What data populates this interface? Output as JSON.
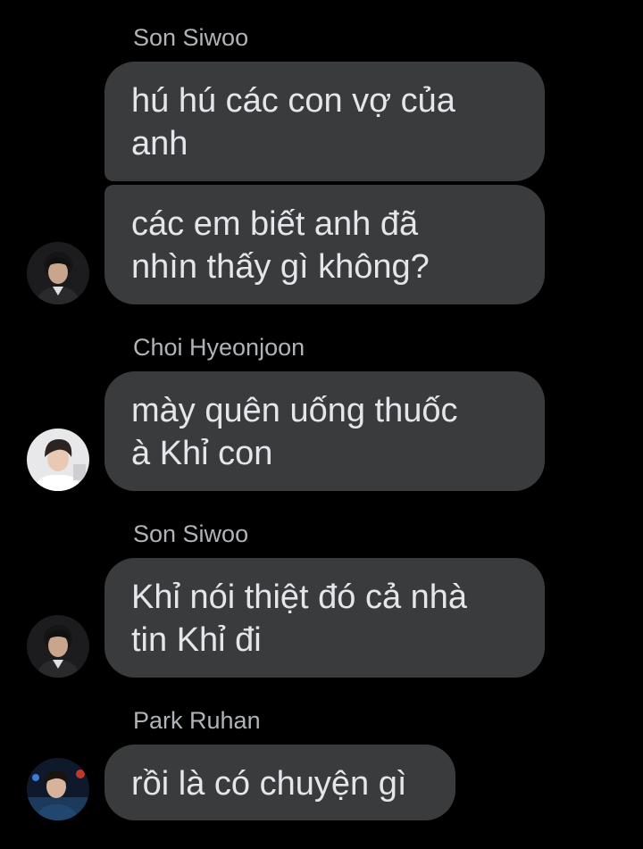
{
  "conversation": {
    "groups": [
      {
        "sender": "Son Siwoo",
        "messages": [
          "hú hú các con vợ của\nanh",
          "các em biết anh đã\nnhìn thấy gì không?"
        ],
        "avatar_icon": "user-avatar-son-siwoo"
      },
      {
        "sender": "Choi Hyeonjoon",
        "messages": [
          "mày quên uống thuốc\nà Khỉ con"
        ],
        "avatar_icon": "user-avatar-choi-hyeonjoon"
      },
      {
        "sender": "Son Siwoo",
        "messages": [
          "Khỉ nói thiệt đó cả nhà\ntin Khỉ đi"
        ],
        "avatar_icon": "user-avatar-son-siwoo"
      },
      {
        "sender": "Park Ruhan",
        "messages": [
          "rồi là có chuyện gì"
        ],
        "avatar_icon": "user-avatar-park-ruhan"
      }
    ]
  },
  "colors": {
    "background": "#000000",
    "bubble": "#3a3b3c",
    "bubble_text": "#e4e6eb",
    "sender_text": "#b0b3b8"
  }
}
